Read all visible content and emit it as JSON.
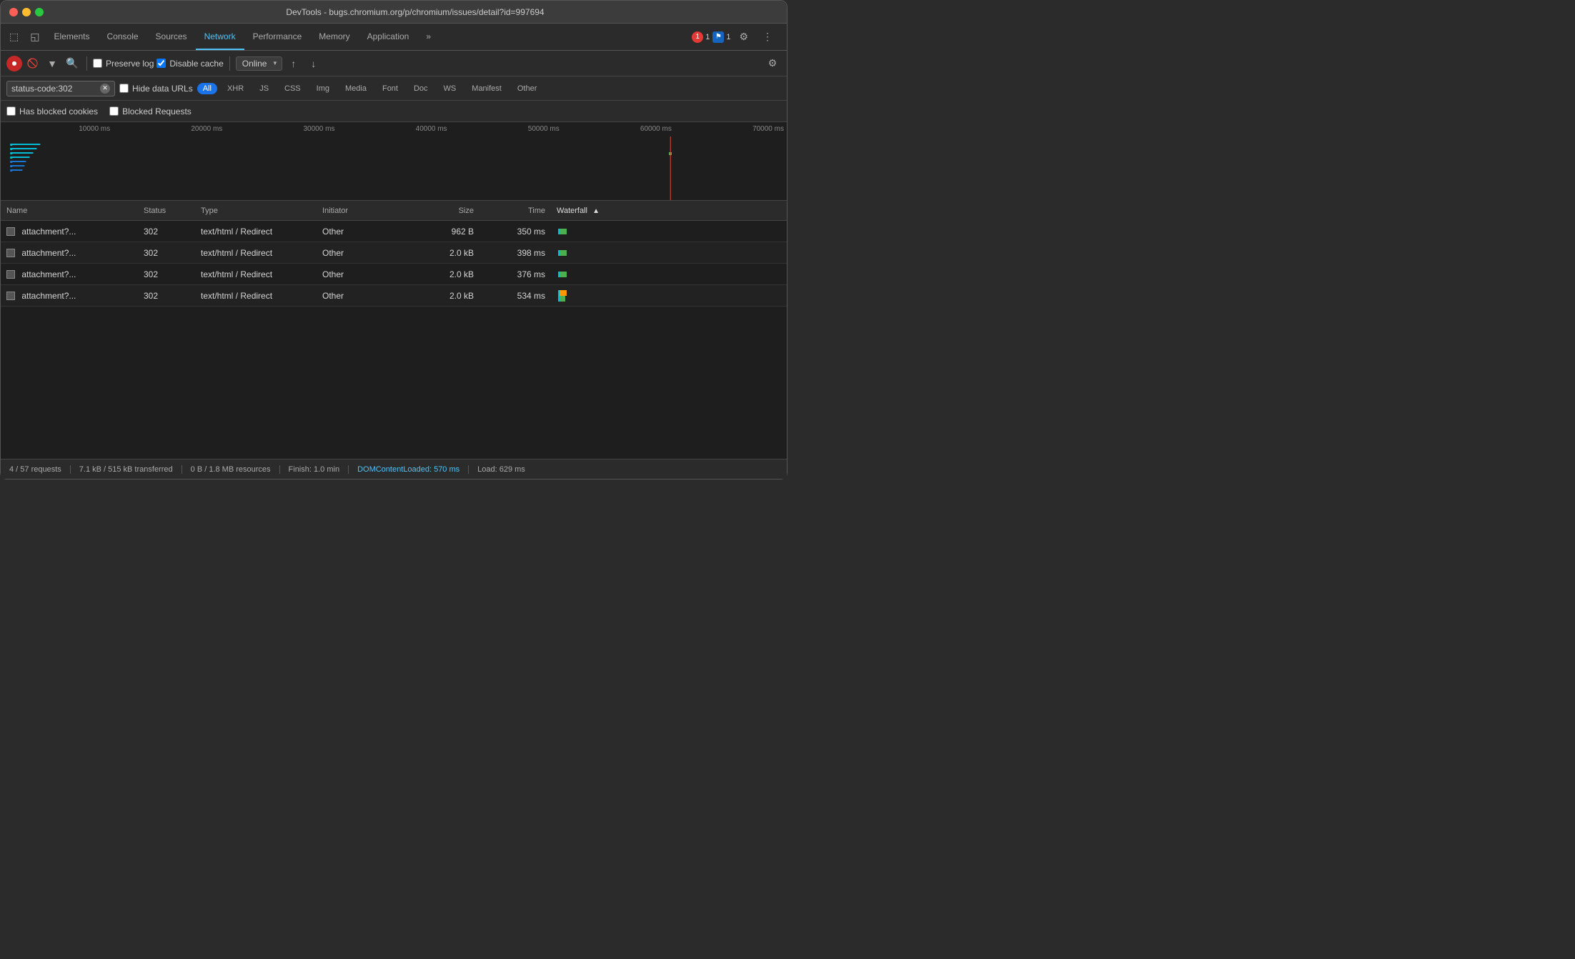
{
  "titleBar": {
    "title": "DevTools - bugs.chromium.org/p/chromium/issues/detail?id=997694"
  },
  "tabs": {
    "items": [
      "Elements",
      "Console",
      "Sources",
      "Network",
      "Performance",
      "Memory",
      "Application"
    ],
    "activeIndex": 3,
    "more": "»"
  },
  "badges": {
    "errorCount": "1",
    "warningCount": "1",
    "settingsIcon": "⚙",
    "menuIcon": "⋮"
  },
  "toolbar": {
    "recordIcon": "⏺",
    "stopIcon": "🚫",
    "filterIcon": "▼",
    "searchIcon": "🔍",
    "preserveLog": "Preserve log",
    "disableCache": "Disable cache",
    "disableCacheChecked": true,
    "preserveLogChecked": false,
    "online": "Online",
    "uploadIcon": "↑",
    "downloadIcon": "↓",
    "settingsIcon": "⚙"
  },
  "filter": {
    "searchValue": "status-code:302",
    "hideDataUrls": "Hide data URLs",
    "allLabel": "All",
    "types": [
      "XHR",
      "JS",
      "CSS",
      "Img",
      "Media",
      "Font",
      "Doc",
      "WS",
      "Manifest",
      "Other"
    ],
    "activeType": "All"
  },
  "checkboxRow": {
    "hasBlockedCookies": "Has blocked cookies",
    "blockedRequests": "Blocked Requests"
  },
  "timelineLabels": [
    "10000 ms",
    "20000 ms",
    "30000 ms",
    "40000 ms",
    "50000 ms",
    "60000 ms",
    "70000 ms"
  ],
  "table": {
    "columns": {
      "name": "Name",
      "status": "Status",
      "type": "Type",
      "initiator": "Initiator",
      "size": "Size",
      "time": "Time",
      "waterfall": "Waterfall"
    },
    "rows": [
      {
        "name": "attachment?...",
        "status": "302",
        "type": "text/html / Redirect",
        "initiator": "Other",
        "size": "962 B",
        "time": "350 ms",
        "waterfallOffset": 0,
        "waterfallWidth": 3
      },
      {
        "name": "attachment?...",
        "status": "302",
        "type": "text/html / Redirect",
        "initiator": "Other",
        "size": "2.0 kB",
        "time": "398 ms",
        "waterfallOffset": 0,
        "waterfallWidth": 3
      },
      {
        "name": "attachment?...",
        "status": "302",
        "type": "text/html / Redirect",
        "initiator": "Other",
        "size": "2.0 kB",
        "time": "376 ms",
        "waterfallOffset": 0,
        "waterfallWidth": 3
      },
      {
        "name": "attachment?...",
        "status": "302",
        "type": "text/html / Redirect",
        "initiator": "Other",
        "size": "2.0 kB",
        "time": "534 ms",
        "waterfallOffset": 0,
        "waterfallWidth": 3
      }
    ]
  },
  "statusBar": {
    "requests": "4 / 57 requests",
    "transferred": "7.1 kB / 515 kB transferred",
    "resources": "0 B / 1.8 MB resources",
    "finish": "Finish: 1.0 min",
    "domContentLoaded": "DOMContentLoaded: 570 ms",
    "load": "Load: 629 ms"
  }
}
